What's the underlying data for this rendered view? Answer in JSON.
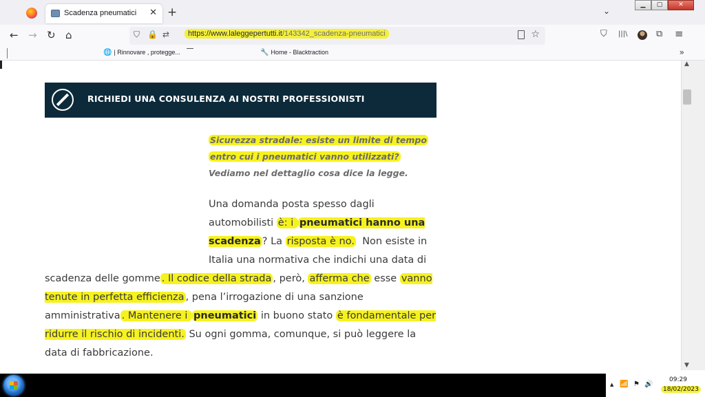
{
  "browser": {
    "tab": {
      "title": "Scadenza pneumatici",
      "close": "✕"
    },
    "new_tab": "+",
    "tab_list": "⌄",
    "window": {
      "min": "▁",
      "max": "▢",
      "close": "✕"
    },
    "nav": {
      "back": "←",
      "forward": "→",
      "reload": "↻",
      "home": "⌂"
    },
    "url": {
      "domain": "https://www.laleggepertutti.it",
      "path": "/143342_scadenza-pneumatici"
    },
    "icons": {
      "shield": "⛉",
      "lock": "🔒",
      "perm": "⇄",
      "star": "☆",
      "pocket": "⛉",
      "library": "|||\\",
      "extensions": "⧉",
      "menu": "≡"
    }
  },
  "bookmarks": [
    {
      "icon": "🌐",
      "label": "| Rinnovare , protegge..."
    },
    {
      "icon": "🔧",
      "label": "Home - Blacktraction"
    }
  ],
  "bookmarks_more": "»",
  "article": {
    "banner": "RICHIEDI UNA CONSULENZA AI NOSTRI PROFESSIONISTI",
    "lead": {
      "line1": "Sicurezza stradale: esiste un limite di tempo",
      "line2": "entro cui i pneumatici vanno utilizzati?",
      "line3": "Vediamo nel dettaglio cosa dice la legge."
    },
    "p1": {
      "a": "Una domanda posta spesso dagli automobilisti ",
      "b": "è: i ",
      "c": "pneumatici hanno una scadenza",
      "d": "? La ",
      "e": "risposta è no.",
      "f": " Non esiste in Italia una normativa che indichi una data di scadenza delle gomme",
      "g": ". Il codice della strada",
      "h": ", però, ",
      "i": "afferma che",
      "j": " esse ",
      "k": "vanno tenute in perfetta efficienza",
      "l": ", pena l’irrogazione di una sanzione amministrativa",
      "m": ". Mantenere i ",
      "n": "pneumatici",
      "o": " in buono stato ",
      "p": "è fondamentale per ridurre il rischio di incidenti.",
      "q": " Su ogni gomma, comunque, si può leggere la data di fabbricazione."
    }
  },
  "scrollbar": {
    "up": "▲",
    "down": "▼"
  },
  "taskbar": {
    "tray_icons": {
      "arrow": "▲",
      "signal": "📶",
      "flag": "⚑",
      "volume": "🔊"
    },
    "time": "09:29",
    "date": "18/02/2023"
  }
}
